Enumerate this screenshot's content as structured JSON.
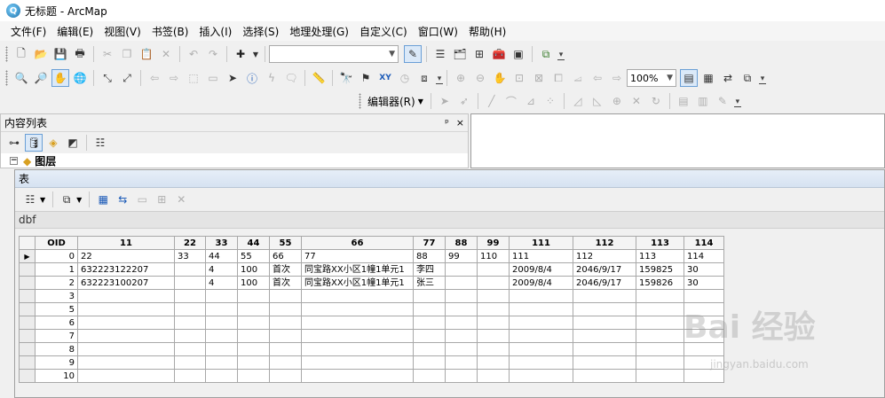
{
  "window": {
    "title": "无标题 - ArcMap",
    "icon": "arcmap-globe-icon"
  },
  "menu": [
    "文件(F)",
    "编辑(E)",
    "视图(V)",
    "书签(B)",
    "插入(I)",
    "选择(S)",
    "地理处理(G)",
    "自定义(C)",
    "窗口(W)",
    "帮助(H)"
  ],
  "toolbar": {
    "scale_value": "",
    "zoom_value": "100%",
    "editor_label": "编辑器(R)"
  },
  "toc": {
    "title": "内容列表",
    "pin": "ᵖ",
    "close": "×",
    "layers_label": "图层"
  },
  "table_window": {
    "title": "表",
    "tab_name": "dbf",
    "columns": [
      "OID",
      "11",
      "22",
      "33",
      "44",
      "55",
      "66",
      "77",
      "88",
      "99",
      "111",
      "112",
      "113",
      "114"
    ],
    "rows": [
      [
        "0",
        "22",
        "33",
        "44",
        "55",
        "66",
        "77",
        "88",
        "99",
        "110",
        "111",
        "112",
        "113",
        "114"
      ],
      [
        "1",
        "632223122207",
        "",
        "4",
        "100",
        "首次",
        "同宝路XX小区1幢1单元1",
        "李四",
        "",
        "",
        "2009/8/4",
        "2046/9/17",
        "159825",
        "30"
      ],
      [
        "2",
        "632223100207",
        "",
        "4",
        "100",
        "首次",
        "同宝路XX小区1幢1单元1",
        "张三",
        "",
        "",
        "2009/8/4",
        "2046/9/17",
        "159826",
        "30"
      ],
      [
        "3",
        "",
        "",
        "",
        "",
        "",
        "",
        "",
        "",
        "",
        "",
        "",
        "",
        ""
      ],
      [
        "5",
        "",
        "",
        "",
        "",
        "",
        "",
        "",
        "",
        "",
        "",
        "",
        "",
        ""
      ],
      [
        "6",
        "",
        "",
        "",
        "",
        "",
        "",
        "",
        "",
        "",
        "",
        "",
        "",
        ""
      ],
      [
        "7",
        "",
        "",
        "",
        "",
        "",
        "",
        "",
        "",
        "",
        "",
        "",
        "",
        ""
      ],
      [
        "8",
        "",
        "",
        "",
        "",
        "",
        "",
        "",
        "",
        "",
        "",
        "",
        "",
        ""
      ],
      [
        "9",
        "",
        "",
        "",
        "",
        "",
        "",
        "",
        "",
        "",
        "",
        "",
        "",
        ""
      ],
      [
        "10",
        "",
        "",
        "",
        "",
        "",
        "",
        "",
        "",
        "",
        "",
        "",
        "",
        ""
      ]
    ],
    "extra_row_label": "4"
  },
  "watermark": {
    "brand": "Bai 经验",
    "url": "jingyan.baidu.com"
  },
  "colors": {
    "title_bar_grad_top": "#e6eef8",
    "active_tool_border": "#6a9fd6"
  }
}
